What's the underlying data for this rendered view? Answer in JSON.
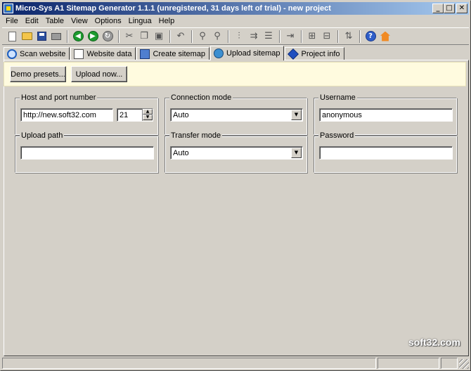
{
  "window": {
    "title": "Micro-Sys A1 Sitemap Generator 1.1.1 (unregistered, 31 days left of trial) - new project",
    "minimize": "_",
    "maximize": "□",
    "close": "✕"
  },
  "menu": [
    "File",
    "Edit",
    "Table",
    "View",
    "Options",
    "Lingua",
    "Help"
  ],
  "toolbar_icons": [
    "new-icon",
    "open-icon",
    "save-icon",
    "print-icon",
    "back-icon",
    "forward-icon",
    "refresh-icon",
    "cut-icon",
    "copy-icon",
    "paste-icon",
    "undo-icon",
    "find-icon",
    "find-next-icon",
    "insert-icon",
    "move-icon",
    "list-icon",
    "export-icon",
    "expand-icon",
    "collapse-icon",
    "sort-icon",
    "help-icon",
    "home-icon"
  ],
  "tabs": [
    {
      "label": "Scan website",
      "icon": "scan-icon",
      "active": false
    },
    {
      "label": "Website data",
      "icon": "data-icon",
      "active": false
    },
    {
      "label": "Create sitemap",
      "icon": "create-icon",
      "active": false
    },
    {
      "label": "Upload sitemap",
      "icon": "upload-icon",
      "active": true
    },
    {
      "label": "Project info",
      "icon": "info-icon",
      "active": false
    }
  ],
  "buttons": {
    "demo_presets": "Demo presets...",
    "upload_now": "Upload now..."
  },
  "form": {
    "host": {
      "label": "Host and port number",
      "value": "http://new.soft32.com",
      "port": "21"
    },
    "connection": {
      "label": "Connection mode",
      "value": "Auto"
    },
    "username": {
      "label": "Username",
      "value": "anonymous"
    },
    "upload_path": {
      "label": "Upload path",
      "value": ""
    },
    "transfer": {
      "label": "Transfer mode",
      "value": "Auto"
    },
    "password": {
      "label": "Password",
      "value": ""
    }
  },
  "watermark": "soft32.com"
}
